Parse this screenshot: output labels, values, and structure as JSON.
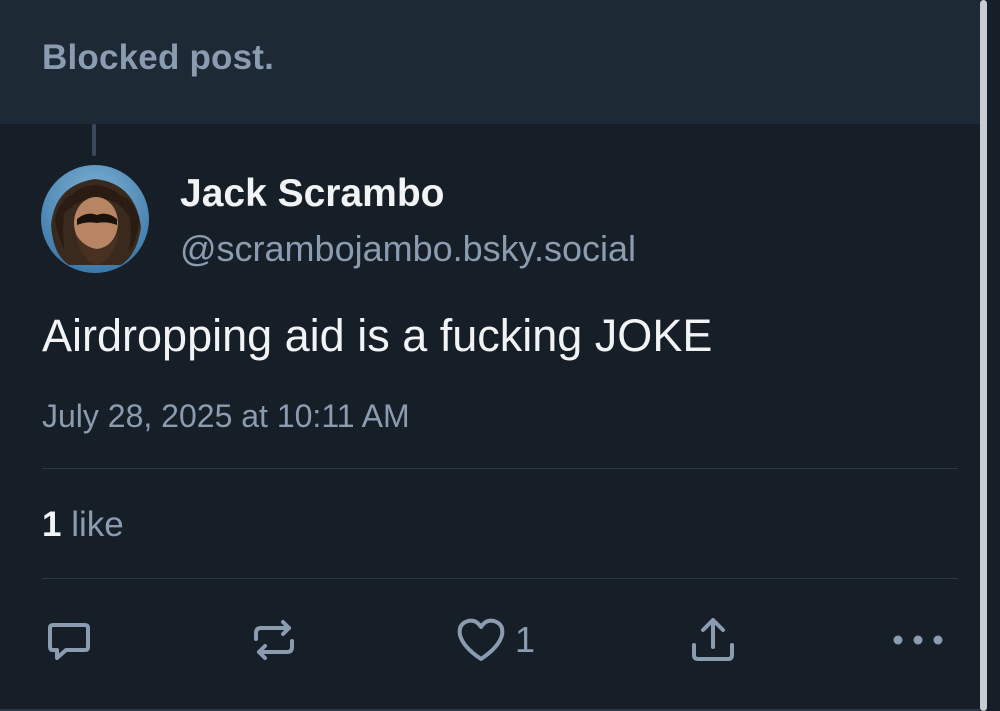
{
  "blocked": {
    "label": "Blocked post."
  },
  "post": {
    "author": {
      "display_name": "Jack Scrambo",
      "handle": "@scrambojambo.bsky.social"
    },
    "text": "Airdropping aid is a fucking JOKE",
    "timestamp": "July 28, 2025 at 10:11 AM",
    "likes": {
      "count": "1",
      "label": "like"
    }
  },
  "actions": {
    "reply_icon": "reply-icon",
    "repost_icon": "repost-icon",
    "like_icon": "heart-icon",
    "like_count": "1",
    "share_icon": "share-icon",
    "more_icon": "more-icon"
  },
  "colors": {
    "background": "#161e27",
    "banner": "#1e2936",
    "text_primary": "#f1f3f5",
    "text_secondary": "#8b9cb0"
  }
}
